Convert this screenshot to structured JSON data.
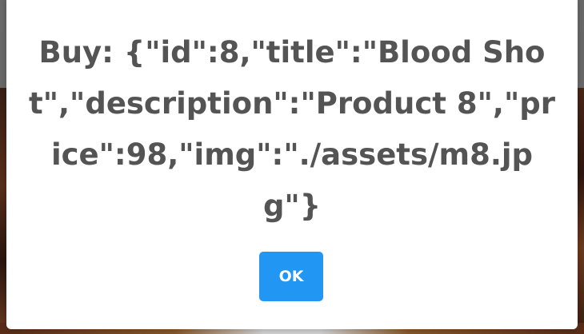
{
  "dialog": {
    "message": "Buy: {\"id\":8,\"title\":\"Blood Shot\",\"description\":\"Product 8\",\"price\":98,\"img\":\"./assets/m8.jpg\"}",
    "ok_label": "OK"
  },
  "colors": {
    "ok_button": "#2196f3",
    "message_text": "#545454",
    "overlay": "#5e5e5e"
  }
}
